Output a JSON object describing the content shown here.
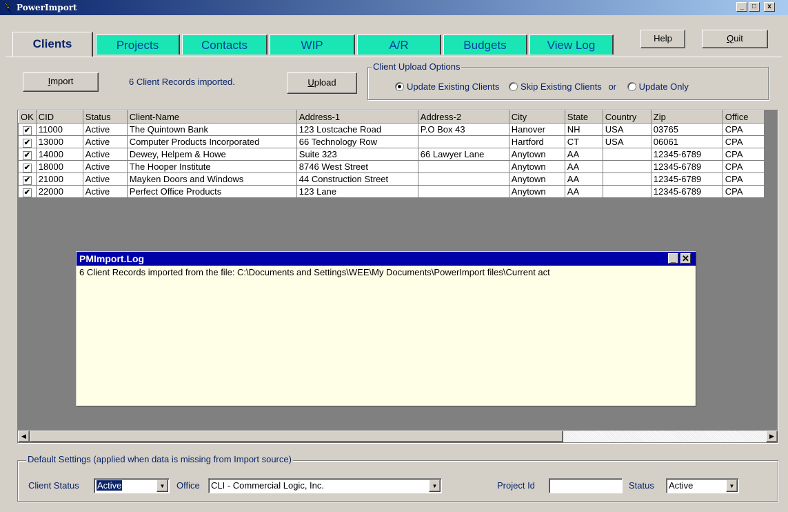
{
  "window": {
    "title": "PowerImport",
    "controls": [
      "_",
      "□",
      "x"
    ]
  },
  "tabs": [
    {
      "label": "Clients",
      "active": true
    },
    {
      "label": "Projects"
    },
    {
      "label": "Contacts"
    },
    {
      "label": "WIP"
    },
    {
      "label": "A/R"
    },
    {
      "label": "Budgets"
    },
    {
      "label": "View Log"
    }
  ],
  "header_buttons": {
    "help": "Help",
    "quit_prefix": "",
    "quit_ul": "Q",
    "quit_rest": "uit"
  },
  "import_bar": {
    "import_ul": "I",
    "import_rest": "mport",
    "status": "6 Client Records imported.",
    "upload_ul": "U",
    "upload_rest": "pload"
  },
  "upload_options": {
    "legend": "Client Upload Options",
    "options": [
      {
        "label": "Update Existing Clients",
        "selected": true
      },
      {
        "label": "Skip Existing Clients",
        "selected": false
      },
      {
        "label": "Update Only",
        "selected": false
      }
    ],
    "or_text": "or"
  },
  "grid": {
    "columns": [
      "OK",
      "CID",
      "Status",
      "Client-Name",
      "Address-1",
      "Address-2",
      "City",
      "State",
      "Country",
      "Zip",
      "Office"
    ],
    "rows": [
      {
        "ok": "✔",
        "cells": [
          "11000",
          "Active",
          "The Quintown Bank",
          "123 Lostcache Road",
          "P.O Box 43",
          "Hanover",
          "NH",
          "USA",
          "03765",
          "CPA"
        ]
      },
      {
        "ok": "✔",
        "cells": [
          "13000",
          "Active",
          "Computer Products Incorporated",
          "66 Technology Row",
          "",
          "Hartford",
          "CT",
          "USA",
          "06061",
          "CPA"
        ]
      },
      {
        "ok": "✔",
        "cells": [
          "14000",
          "Active",
          "Dewey, Helpem & Howe",
          "Suite 323",
          "66 Lawyer Lane",
          "Anytown",
          "AA",
          "",
          "12345-6789",
          "CPA"
        ]
      },
      {
        "ok": "✔",
        "cells": [
          "18000",
          "Active",
          "The Hooper Institute",
          "8746 West Street",
          "",
          "Anytown",
          "AA",
          "",
          "12345-6789",
          "CPA"
        ]
      },
      {
        "ok": "✔",
        "cells": [
          "21000",
          "Active",
          "Mayken Doors and Windows",
          "44 Construction Street",
          "",
          "Anytown",
          "AA",
          "",
          "12345-6789",
          "CPA"
        ]
      },
      {
        "ok": "✔",
        "cells": [
          "22000",
          "Active",
          "Perfect Office Products",
          "123 Lane",
          "",
          "Anytown",
          "AA",
          "",
          "12345-6789",
          "CPA"
        ]
      }
    ]
  },
  "log_window": {
    "title": "PMImport.Log",
    "text": "6 Client Records imported from the file: C:\\Documents and Settings\\WEE\\My Documents\\PowerImport files\\Current act"
  },
  "defaults": {
    "legend": "Default Settings (applied when data is missing from Import source)",
    "client_status_label": "Client Status",
    "client_status_value": "Active",
    "office_label": "Office",
    "office_value": "CLI - Commercial Logic, Inc.",
    "project_id_label": "Project Id",
    "project_id_value": "",
    "status_label": "Status",
    "status_value": "Active"
  },
  "colors": {
    "tab_bg": "#19e6b4",
    "title_blue": "#0a246a",
    "log_title": "#0000a8",
    "log_bg": "#ffffe8"
  }
}
